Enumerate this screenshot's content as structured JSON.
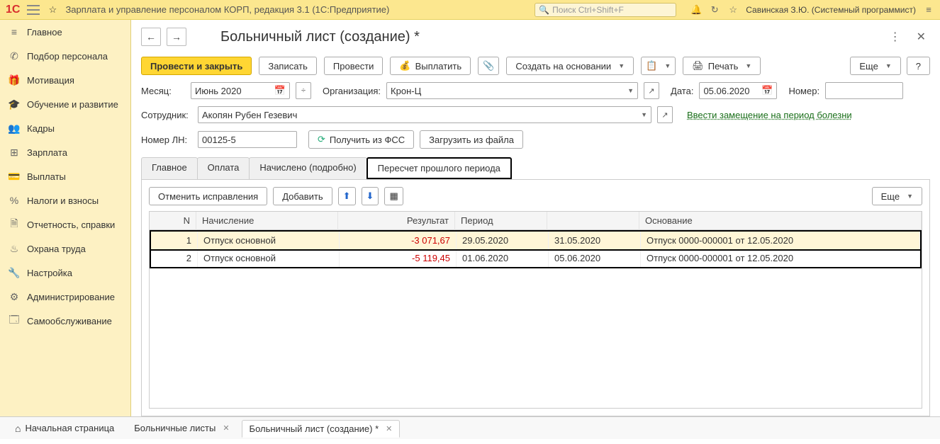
{
  "topbar": {
    "app_title": "Зарплата и управление персоналом КОРП, редакция 3.1  (1С:Предприятие)",
    "search_placeholder": "Поиск Ctrl+Shift+F",
    "user_name": "Савинская З.Ю. (Системный программист)"
  },
  "sidebar": {
    "items": [
      {
        "label": "Главное"
      },
      {
        "label": "Подбор персонала"
      },
      {
        "label": "Мотивация"
      },
      {
        "label": "Обучение и развитие"
      },
      {
        "label": "Кадры"
      },
      {
        "label": "Зарплата"
      },
      {
        "label": "Выплаты"
      },
      {
        "label": "Налоги и взносы"
      },
      {
        "label": "Отчетность, справки"
      },
      {
        "label": "Охрана труда"
      },
      {
        "label": "Настройка"
      },
      {
        "label": "Администрирование"
      },
      {
        "label": "Самообслуживание"
      }
    ]
  },
  "document": {
    "title": "Больничный лист (создание) *",
    "toolbar": {
      "post_close": "Провести и закрыть",
      "save": "Записать",
      "post": "Провести",
      "pay": "Выплатить",
      "create_based": "Создать на основании",
      "print": "Печать",
      "more": "Еще",
      "help": "?"
    },
    "fields": {
      "month_label": "Месяц:",
      "month_value": "Июнь 2020",
      "org_label": "Организация:",
      "org_value": "Крон-Ц",
      "date_label": "Дата:",
      "date_value": "05.06.2020",
      "number_label": "Номер:",
      "number_value": "",
      "employee_label": "Сотрудник:",
      "employee_value": "Акопян Рубен Гезевич",
      "substitute_link": "Ввести замещение на период болезни",
      "ln_label": "Номер ЛН:",
      "ln_value": "00125-5",
      "btn_fss": "Получить из ФСС",
      "btn_load_file": "Загрузить из файла"
    },
    "tabs": [
      "Главное",
      "Оплата",
      "Начислено (подробно)",
      "Пересчет прошлого периода"
    ],
    "active_tab": 3,
    "tab_toolbar": {
      "cancel_fix": "Отменить исправления",
      "add": "Добавить",
      "more": "Еще"
    },
    "table": {
      "headers": {
        "n": "N",
        "name": "Начисление",
        "result": "Результат",
        "period": "Период",
        "base": "Основание"
      },
      "rows": [
        {
          "n": "1",
          "name": "Отпуск основной",
          "result": "-3 071,67",
          "p1": "29.05.2020",
          "p2": "31.05.2020",
          "base": "Отпуск 0000-000001 от 12.05.2020"
        },
        {
          "n": "2",
          "name": "Отпуск основной",
          "result": "-5 119,45",
          "p1": "01.06.2020",
          "p2": "05.06.2020",
          "base": "Отпуск 0000-000001 от 12.05.2020"
        }
      ]
    }
  },
  "bottom_tabs": {
    "home": "Начальная страница",
    "tabs": [
      {
        "label": "Больничные листы"
      },
      {
        "label": "Больничный лист (создание) *",
        "active": true
      }
    ]
  }
}
